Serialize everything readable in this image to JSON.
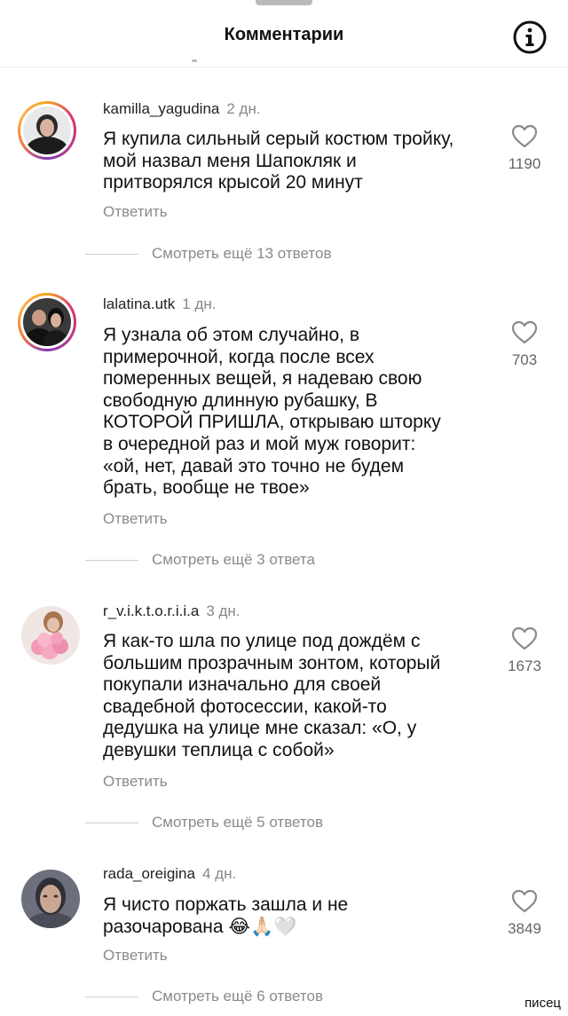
{
  "header": {
    "title": "Комментарии",
    "info_icon": "info-circle-icon"
  },
  "comments": [
    {
      "username": "kamilla_yagudina",
      "time": "2 дн.",
      "lines": [
        "Я купила сильный серый костюм тройку,",
        "мой назвал меня Шапокляк и",
        "притворялся крысой 20 минут"
      ],
      "reply_label": "Ответить",
      "likes": "1190",
      "more_replies": "Смотреть ещё 13 ответов"
    },
    {
      "username": "lalatina.utk",
      "time": "1 дн.",
      "lines": [
        "Я узнала об этом случайно, в",
        "примерочной, когда после всех",
        "померенных вещей, я надеваю свою",
        "свободную длинную рубашку, В",
        "КОТОРОЙ ПРИШЛА, открываю шторку",
        "в очередной раз и мой муж говорит:",
        "«ой, нет, давай это точно не будем",
        "брать, вообще не твое»"
      ],
      "reply_label": "Ответить",
      "likes": "703",
      "more_replies": "Смотреть ещё 3 ответа"
    },
    {
      "username": "r_v.i.k.t.o.r.i.i.a",
      "time": "3 дн.",
      "lines": [
        "Я как-то шла по улице под дождём с",
        "большим прозрачным зонтом, который",
        "покупали изначально для своей",
        "свадебной фотосессии, какой-то",
        "дедушка на улице мне сказал: «О, у",
        "девушки теплица с собой»"
      ],
      "reply_label": "Ответить",
      "likes": "1673",
      "more_replies": "Смотреть ещё 5 ответов"
    },
    {
      "username": "rada_oreigina",
      "time": "4 дн.",
      "lines": [
        "Я чисто поржать зашла и не",
        "разочарована 😂🙏🏻🤍"
      ],
      "reply_label": "Ответить",
      "likes": "3849",
      "more_replies": "Смотреть ещё 6 ответов"
    }
  ],
  "watermark": "писец"
}
